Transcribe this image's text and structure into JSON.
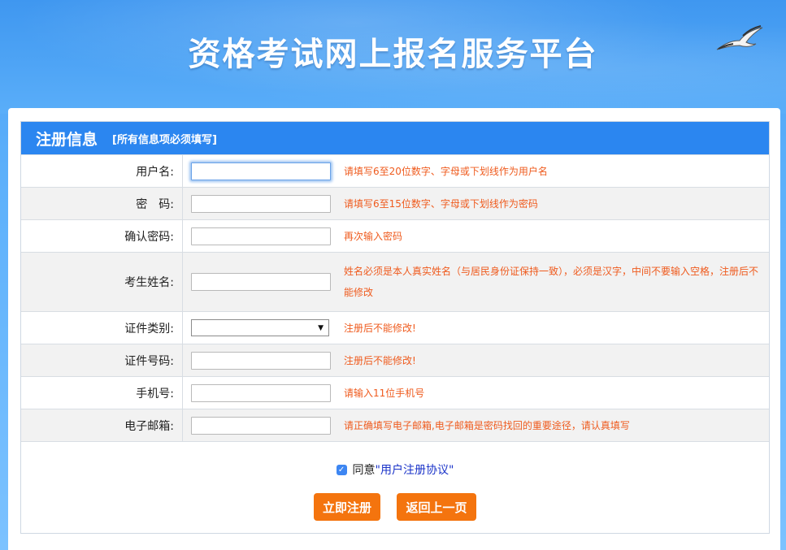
{
  "site_title": "资格考试网上报名服务平台",
  "form": {
    "header_title": "注册信息",
    "header_note": "[所有信息项必须填写]",
    "fields": [
      {
        "label": "用户名:",
        "value": "",
        "hint": "请填写6至20位数字、字母或下划线作为用户名"
      },
      {
        "label": "密　码:",
        "value": "",
        "hint": "请填写6至15位数字、字母或下划线作为密码"
      },
      {
        "label": "确认密码:",
        "value": "",
        "hint": "再次输入密码"
      },
      {
        "label": "考生姓名:",
        "value": "",
        "hint": "姓名必须是本人真实姓名（与居民身份证保持一致），必须是汉字，中间不要输入空格，注册后不能修改"
      },
      {
        "label": "证件类别:",
        "value": "",
        "hint": "注册后不能修改!"
      },
      {
        "label": "证件号码:",
        "value": "",
        "hint": "注册后不能修改!"
      },
      {
        "label": "手机号:",
        "value": "",
        "hint": "请输入11位手机号"
      },
      {
        "label": "电子邮箱:",
        "value": "",
        "hint": "请正确填写电子邮箱,电子邮箱是密码找回的重要途径，请认真填写"
      }
    ],
    "agree_prefix": "同意",
    "agree_link": "\"用户注册协议\"",
    "agree_checked": true,
    "register_button": "立即注册",
    "back_button": "返回上一页"
  },
  "colors": {
    "header_blue": "#2b86f0",
    "hint_orange": "#ef5b1e",
    "button_orange": "#f4740e",
    "link_blue": "#1b34c9"
  },
  "icons": {
    "bird": "seagull-icon",
    "select_arrow": "chevron-down-icon",
    "check": "check-icon"
  }
}
